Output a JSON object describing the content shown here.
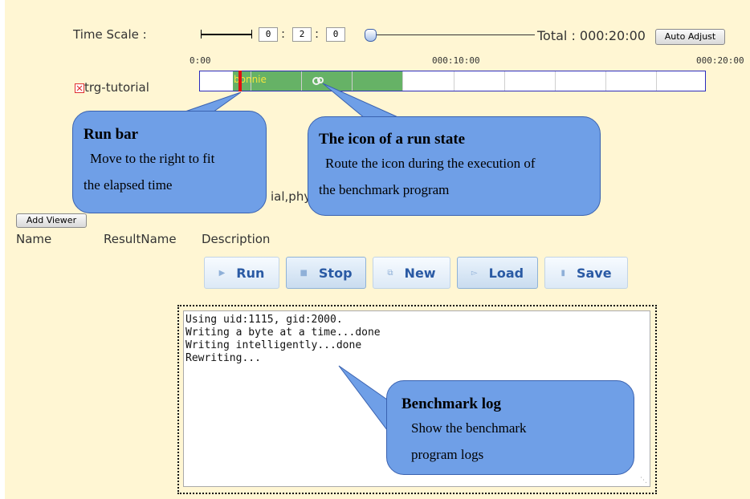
{
  "time_scale": {
    "label": "Time Scale :",
    "hours": "0",
    "minutes": "2",
    "seconds": "0",
    "separator": ":",
    "total_text": "Total : 000:20:00",
    "auto_adjust_label": "Auto Adjust",
    "slider_level": 0.05
  },
  "timeline": {
    "ticks": [
      "0:00",
      "000:10:00",
      "000:20:00"
    ],
    "track_name": "trg-tutorial",
    "bar_label": "bonnie",
    "progress_fraction": 0.4,
    "run_bar_fraction": 0.077
  },
  "hidden_text_fragment": "ial,phy",
  "viewer": {
    "add_viewer_label": "Add Viewer",
    "columns": [
      "Name",
      "ResultName",
      "Description"
    ]
  },
  "controls": {
    "run": "Run",
    "stop": "Stop",
    "new": "New",
    "load": "Load",
    "save": "Save"
  },
  "log": {
    "lines": [
      "Using uid:1115, gid:2000.",
      "Writing a byte at a time...done",
      "Writing intelligently...done",
      "Rewriting..."
    ]
  },
  "callouts": {
    "run_bar": {
      "title": "Run bar",
      "line1": "Move to the right to fit",
      "line2": "the elapsed time"
    },
    "run_state": {
      "title": "The icon of a run state",
      "line1": "Route the icon during the execution of",
      "line2": "the benchmark program"
    },
    "benchmark_log": {
      "title": "Benchmark log",
      "line1": "Show the benchmark",
      "line2": "program logs"
    }
  },
  "colors": {
    "panel_bg": "#fff6d3",
    "progress_green": "#66b266",
    "run_bar_red": "#e01010",
    "timeline_border": "#2b2bbd",
    "callout_blue": "#6f9fe7",
    "button_text": "#2a5aa4"
  },
  "icons": {
    "track_status": "red-x-box-icon",
    "run_state": "spinner-icon",
    "run": "play-triangle-icon",
    "stop": "stop-square-icon",
    "new": "new-document-icon",
    "load": "open-folder-icon",
    "save": "save-disk-icon"
  }
}
